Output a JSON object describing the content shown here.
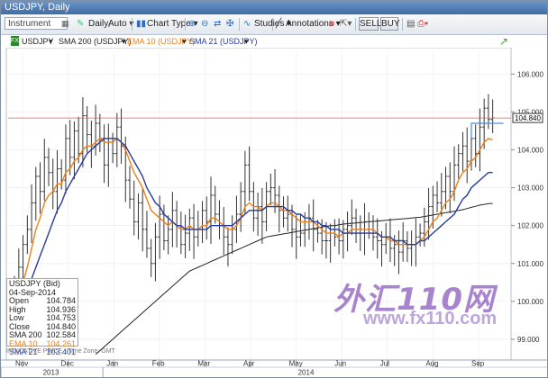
{
  "window": {
    "title": "USDJPY, Daily"
  },
  "toolbar": {
    "instrument_placeholder": "Instrument",
    "period": "Daily,",
    "auto": "Auto",
    "chart_type": "Chart Type",
    "studies": "Studies",
    "annotations": "Annotations",
    "sell": "SELL",
    "buy": "BUY"
  },
  "legend": {
    "symbol": "USDJPY",
    "sma200": "SMA 200 (USDJPY)",
    "ema10": "EMA 10 (USDJPY)",
    "sma21": "SMA 21 (USDJPY)"
  },
  "colors": {
    "price": "#333333",
    "sma200": "#222222",
    "ema10": "#f07f16",
    "sma21": "#283c9c",
    "last_line": "#e05c4a",
    "level_line": "#4a8fd6"
  },
  "infobox": {
    "title": "USDJPY (Bid)",
    "date": "04-Sep-2014",
    "rows": [
      {
        "k": "Open",
        "v": "104.784"
      },
      {
        "k": "High",
        "v": "104.936"
      },
      {
        "k": "Low",
        "v": "104.753"
      },
      {
        "k": "Close",
        "v": "104.840"
      },
      {
        "k": "SMA 200",
        "v": "102.584"
      },
      {
        "k": "EMA 10",
        "v": "104.261"
      },
      {
        "k": "SMA 21",
        "v": "103.401"
      }
    ]
  },
  "indicative": "INDICATIVE PRICE · Time Zone: GMT",
  "watermark": {
    "cn": "外汇110网",
    "url": "www.fx110.com"
  },
  "chart_data": {
    "type": "line",
    "price_ticks": [
      "106.000",
      "105.000",
      "104.000",
      "103.000",
      "102.000",
      "101.000",
      "100.000",
      "99.000"
    ],
    "last_price": "104.840",
    "month_labels": [
      "Nov",
      "Dec",
      "Jan",
      "Feb",
      "Mar",
      "Apr",
      "May",
      "Jun",
      "Jul",
      "Aug",
      "Sep"
    ],
    "year_labels": [
      "2013",
      "2014"
    ],
    "ylim": [
      98.5,
      106.6
    ],
    "close": [
      99.7,
      100.3,
      100.9,
      101.5,
      101.9,
      102.6,
      103.3,
      102.9,
      103.8,
      103.4,
      102.9,
      103.5,
      103.2,
      104.3,
      103.8,
      104.5,
      103.9,
      104.9,
      104.4,
      104.1,
      104.7,
      104.3,
      103.6,
      104.2,
      103.9,
      104.6,
      104.1,
      103.2,
      102.7,
      102.1,
      102.6,
      101.9,
      101.4,
      101.0,
      101.7,
      102.3,
      101.6,
      101.9,
      102.4,
      102.0,
      101.5,
      101.8,
      102.2,
      101.7,
      101.9,
      102.4,
      102.1,
      102.8,
      102.3,
      102.0,
      101.7,
      101.5,
      101.9,
      102.3,
      102.9,
      103.6,
      102.9,
      102.2,
      102.5,
      102.1,
      102.9,
      103.0,
      102.8,
      102.4,
      102.2,
      102.3,
      101.9,
      101.7,
      101.8,
      102.1,
      102.2,
      101.9,
      101.8,
      101.6,
      101.6,
      101.8,
      101.7,
      101.6,
      101.9,
      102.0,
      102.2,
      101.9,
      101.8,
      102.1,
      101.9,
      101.7,
      101.6,
      101.5,
      101.7,
      101.4,
      101.5,
      101.3,
      101.6,
      101.4,
      101.5,
      101.7,
      101.8,
      102.1,
      102.5,
      102.8,
      102.6,
      102.9,
      103.3,
      102.9,
      103.6,
      103.9,
      104.1,
      103.7,
      104.3,
      103.9,
      104.6,
      105.1,
      104.8,
      104.84
    ],
    "ema10": [
      99.6,
      99.8,
      100.1,
      100.5,
      100.9,
      101.4,
      101.9,
      102.2,
      102.6,
      102.8,
      102.9,
      103.1,
      103.1,
      103.4,
      103.5,
      103.7,
      103.8,
      104.0,
      104.1,
      104.1,
      104.2,
      104.3,
      104.2,
      104.2,
      104.2,
      104.3,
      104.2,
      104.0,
      103.7,
      103.4,
      103.2,
      103.0,
      102.7,
      102.4,
      102.3,
      102.2,
      102.1,
      102.0,
      102.1,
      102.0,
      101.9,
      101.9,
      102.0,
      101.9,
      101.9,
      102.0,
      102.0,
      102.2,
      102.2,
      102.1,
      102.0,
      101.9,
      101.9,
      102.0,
      102.2,
      102.5,
      102.6,
      102.5,
      102.5,
      102.4,
      102.5,
      102.6,
      102.6,
      102.5,
      102.4,
      102.4,
      102.3,
      102.2,
      102.1,
      102.1,
      102.1,
      102.1,
      102.0,
      101.9,
      101.8,
      101.8,
      101.8,
      101.7,
      101.8,
      101.8,
      101.9,
      101.9,
      101.9,
      101.9,
      101.9,
      101.9,
      101.8,
      101.7,
      101.7,
      101.6,
      101.6,
      101.5,
      101.5,
      101.5,
      101.5,
      101.5,
      101.6,
      101.7,
      101.9,
      102.1,
      102.2,
      102.4,
      102.6,
      102.7,
      102.9,
      103.2,
      103.4,
      103.5,
      103.7,
      103.8,
      104.0,
      104.2,
      104.3,
      104.261
    ],
    "sma21": [
      99.4,
      99.6,
      99.8,
      100.0,
      100.3,
      100.6,
      100.9,
      101.2,
      101.5,
      101.8,
      102.1,
      102.4,
      102.6,
      102.9,
      103.1,
      103.3,
      103.5,
      103.7,
      103.9,
      104.0,
      104.1,
      104.2,
      104.3,
      104.3,
      104.3,
      104.3,
      104.2,
      104.1,
      103.9,
      103.7,
      103.5,
      103.3,
      103.0,
      102.8,
      102.6,
      102.5,
      102.3,
      102.2,
      102.1,
      102.0,
      102.0,
      101.9,
      101.9,
      101.9,
      101.9,
      101.9,
      101.9,
      102.0,
      102.0,
      102.0,
      102.0,
      102.0,
      102.0,
      102.1,
      102.2,
      102.3,
      102.4,
      102.4,
      102.4,
      102.4,
      102.5,
      102.5,
      102.5,
      102.5,
      102.5,
      102.4,
      102.4,
      102.3,
      102.3,
      102.2,
      102.2,
      102.1,
      102.1,
      102.0,
      102.0,
      101.9,
      101.9,
      101.9,
      101.8,
      101.8,
      101.8,
      101.8,
      101.8,
      101.8,
      101.8,
      101.8,
      101.8,
      101.7,
      101.7,
      101.7,
      101.6,
      101.6,
      101.6,
      101.5,
      101.5,
      101.5,
      101.6,
      101.6,
      101.7,
      101.8,
      101.9,
      102.0,
      102.1,
      102.2,
      102.3,
      102.5,
      102.7,
      102.8,
      103.0,
      103.1,
      103.2,
      103.3,
      103.4,
      103.401
    ],
    "sma200": [
      null,
      null,
      null,
      null,
      null,
      null,
      null,
      null,
      null,
      null,
      null,
      null,
      null,
      null,
      null,
      null,
      null,
      null,
      null,
      null,
      98.6,
      98.7,
      98.8,
      98.9,
      99.0,
      99.1,
      99.2,
      99.3,
      99.4,
      99.5,
      99.6,
      99.7,
      99.8,
      99.9,
      100.0,
      100.1,
      100.2,
      100.3,
      100.4,
      100.5,
      100.6,
      100.7,
      100.8,
      100.85,
      100.9,
      100.95,
      101.0,
      101.05,
      101.1,
      101.15,
      101.2,
      101.25,
      101.3,
      101.35,
      101.4,
      101.45,
      101.5,
      101.55,
      101.6,
      101.65,
      101.7,
      101.72,
      101.74,
      101.76,
      101.78,
      101.8,
      101.82,
      101.84,
      101.86,
      101.88,
      101.9,
      101.92,
      101.94,
      101.96,
      101.98,
      102.0,
      102.0,
      102.02,
      102.04,
      102.05,
      102.06,
      102.07,
      102.08,
      102.09,
      102.1,
      102.11,
      102.12,
      102.13,
      102.14,
      102.15,
      102.16,
      102.17,
      102.18,
      102.19,
      102.2,
      102.21,
      102.22,
      102.24,
      102.26,
      102.28,
      102.3,
      102.32,
      102.34,
      102.36,
      102.38,
      102.4,
      102.42,
      102.45,
      102.48,
      102.51,
      102.54,
      102.56,
      102.58,
      102.584
    ]
  }
}
